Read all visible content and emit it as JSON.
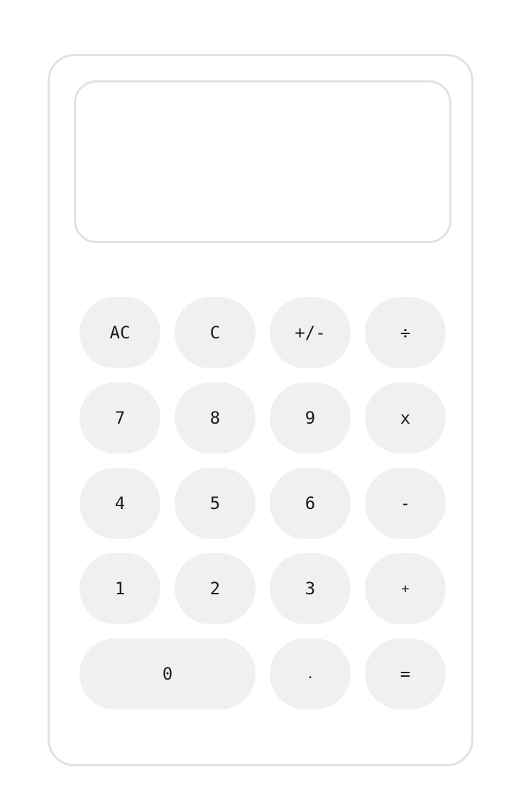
{
  "display": {
    "value": ""
  },
  "keys": {
    "all_clear": "AC",
    "clear": "C",
    "negate": "+/-",
    "divide": "÷",
    "seven": "7",
    "eight": "8",
    "nine": "9",
    "multiply": "x",
    "four": "4",
    "five": "5",
    "six": "6",
    "subtract": "-",
    "one": "1",
    "two": "2",
    "three": "3",
    "add": "+",
    "zero": "0",
    "decimal": ".",
    "equals": "="
  }
}
